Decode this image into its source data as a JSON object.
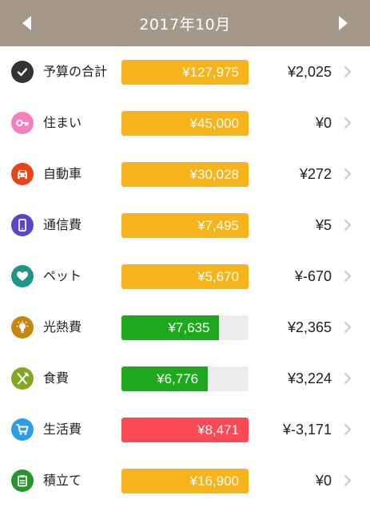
{
  "header": {
    "title": "2017年10月"
  },
  "categories": [
    {
      "label": "予算の合計",
      "amount": "¥127,975",
      "remaining": "¥2,025",
      "fill": 1.0,
      "bar_color": "#f5b41c",
      "icon": "check-circle-icon",
      "icon_color": "#333333"
    },
    {
      "label": "住まい",
      "amount": "¥45,000",
      "remaining": "¥0",
      "fill": 1.0,
      "bar_color": "#f5b41c",
      "icon": "key-icon",
      "icon_color": "#f27fc0"
    },
    {
      "label": "自動車",
      "amount": "¥30,028",
      "remaining": "¥272",
      "fill": 1.0,
      "bar_color": "#f5b41c",
      "icon": "car-icon",
      "icon_color": "#e8441c"
    },
    {
      "label": "通信費",
      "amount": "¥7,495",
      "remaining": "¥5",
      "fill": 1.0,
      "bar_color": "#f5b41c",
      "icon": "smartphone-icon",
      "icon_color": "#5b45c9"
    },
    {
      "label": "ペット",
      "amount": "¥5,670",
      "remaining": "¥-670",
      "fill": 1.0,
      "bar_color": "#f5b41c",
      "icon": "heart-icon",
      "icon_color": "#1f9488"
    },
    {
      "label": "光熱費",
      "amount": "¥7,635",
      "remaining": "¥2,365",
      "fill": 0.77,
      "bar_color": "#1ea81e",
      "icon": "lightbulb-icon",
      "icon_color": "#c8860f"
    },
    {
      "label": "食費",
      "amount": "¥6,776",
      "remaining": "¥3,224",
      "fill": 0.68,
      "bar_color": "#1ea81e",
      "icon": "fork-knife-icon",
      "icon_color": "#86a522"
    },
    {
      "label": "生活費",
      "amount": "¥8,471",
      "remaining": "¥-3,171",
      "fill": 1.0,
      "bar_color": "#fb4a55",
      "icon": "cart-icon",
      "icon_color": "#2b9ee6"
    },
    {
      "label": "積立て",
      "amount": "¥16,900",
      "remaining": "¥0",
      "fill": 1.0,
      "bar_color": "#f5b41c",
      "icon": "clipboard-icon",
      "icon_color": "#24962c"
    }
  ]
}
